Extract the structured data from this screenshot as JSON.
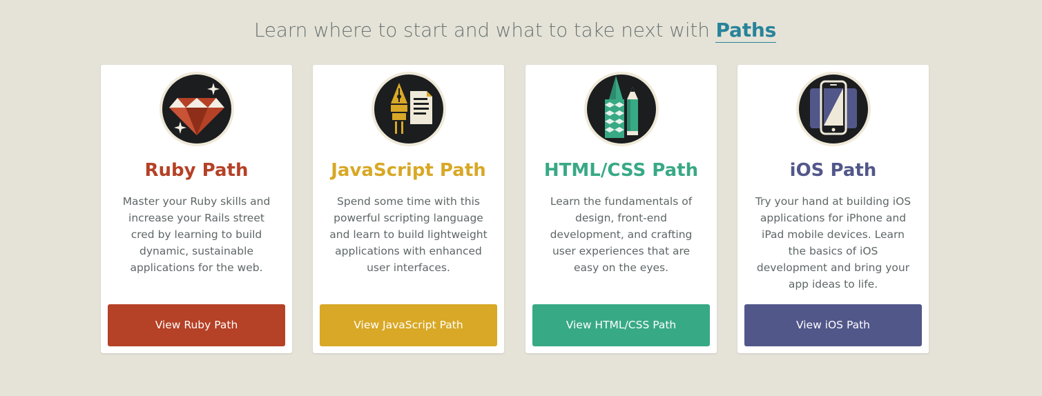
{
  "heading": {
    "prefix": "Learn where to start and what to take next with",
    "link": "Paths"
  },
  "cards": [
    {
      "title": "Ruby Path",
      "description": "Master your Ruby skills and increase your Rails street cred by learning to build dynamic, sustainable applications for the web.",
      "button": "View Ruby Path",
      "color": "#b54126",
      "icon": "ruby-gem-icon"
    },
    {
      "title": "JavaScript Path",
      "description": "Spend some time with this powerful scripting language and learn to build lightweight applications with enhanced user interfaces.",
      "button": "View JavaScript Path",
      "color": "#d8a826",
      "icon": "pen-nib-document-icon"
    },
    {
      "title": "HTML/CSS Path",
      "description": "Learn the fundamentals of design, front-end development, and crafting user experiences that are easy on the eyes.",
      "button": "View HTML/CSS Path",
      "color": "#38a985",
      "icon": "pen-pencil-icon"
    },
    {
      "title": "iOS Path",
      "description": "Try your hand at building iOS applications for iPhone and iPad mobile devices. Learn the basics of iOS development and bring your app ideas to life.",
      "button": "View iOS Path",
      "color": "#52578a",
      "icon": "mobile-devices-icon"
    }
  ]
}
